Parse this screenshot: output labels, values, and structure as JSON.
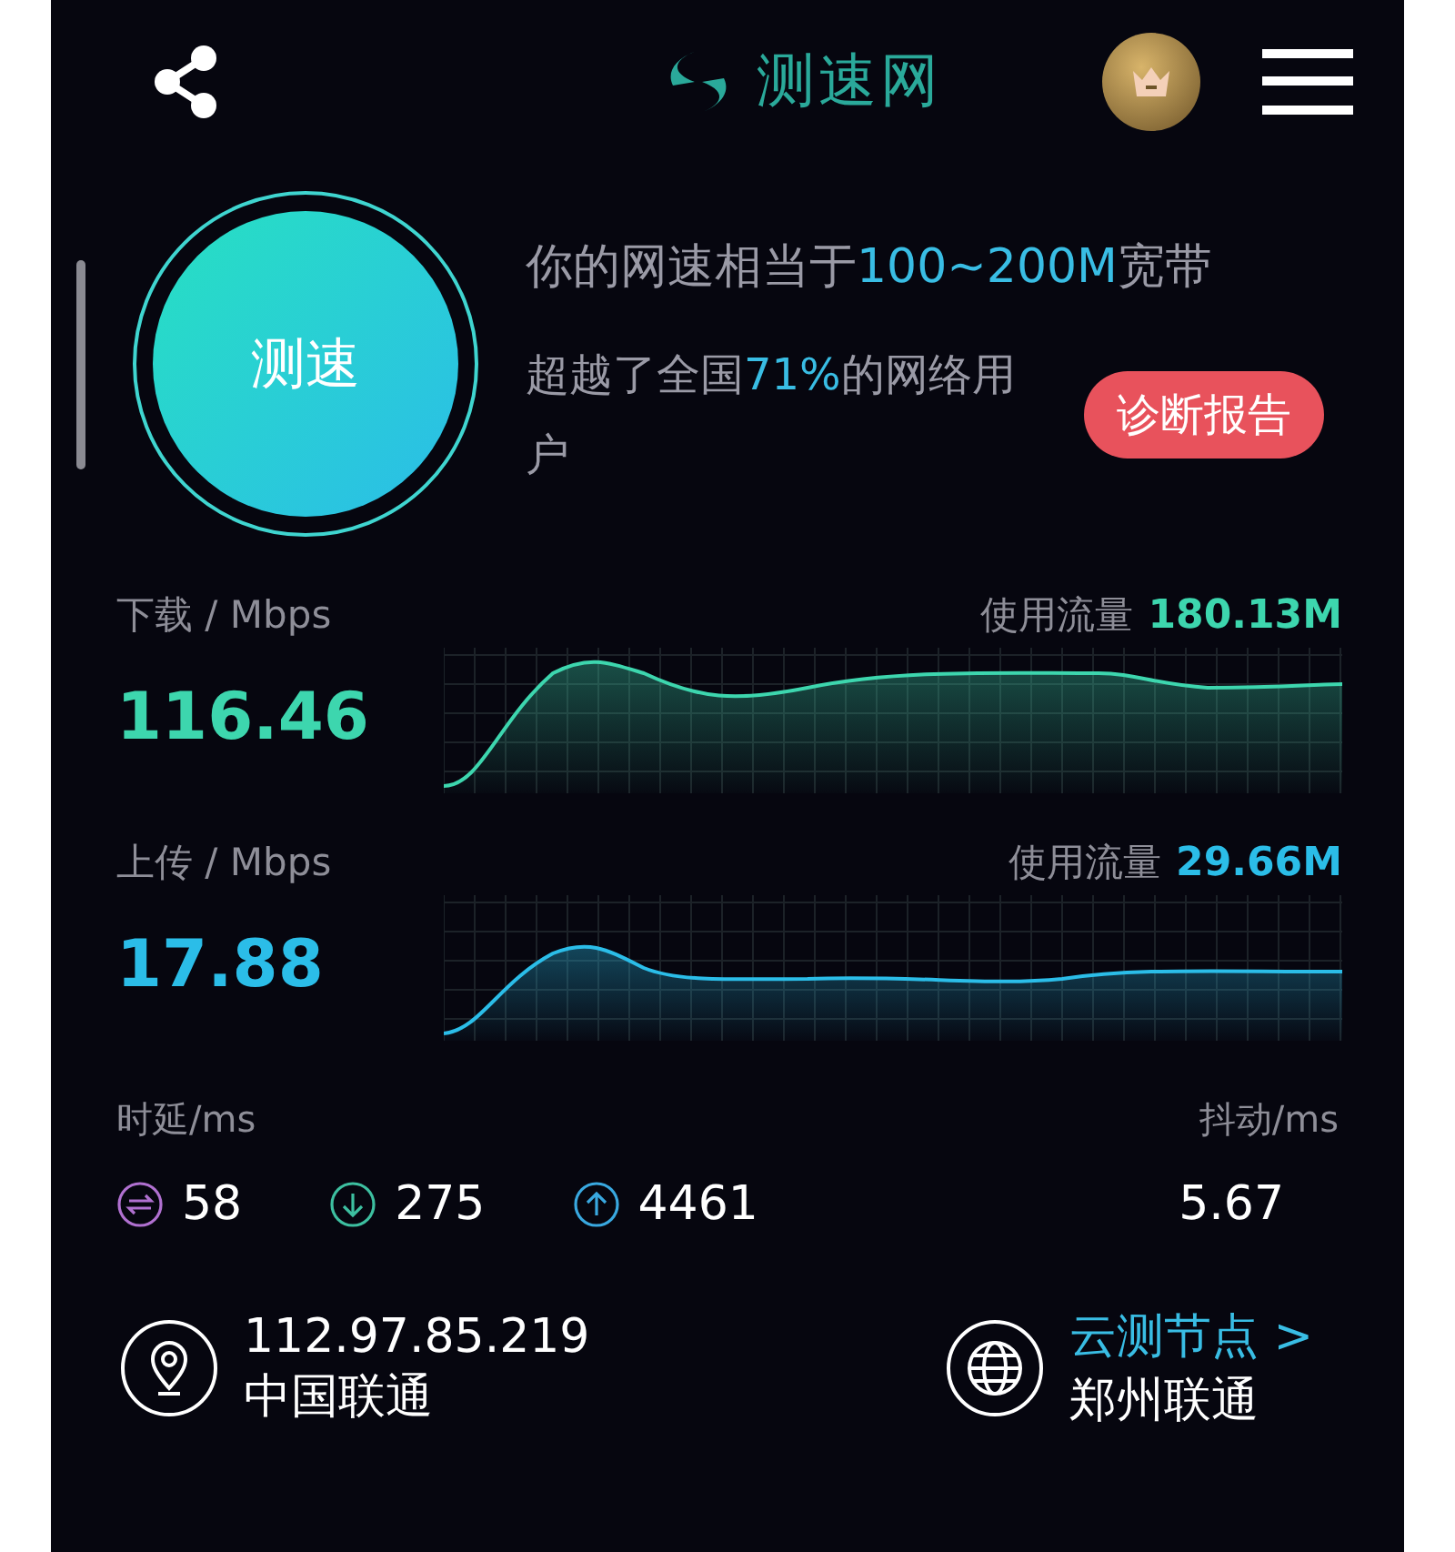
{
  "header": {
    "logo_text": "测速网"
  },
  "test_button": {
    "label": "测速"
  },
  "summary": {
    "lines": [
      "你的网速相当于**100~200M**宽带",
      "超越了全国**71%**的网络用户"
    ],
    "report_button": "诊断报告"
  },
  "meters": [
    {
      "kind": "download",
      "label": "下载 / Mbps",
      "value": "116.46",
      "usage_label": "使用流量",
      "usage": "180.13M"
    },
    {
      "kind": "upload",
      "label": "上传 / Mbps",
      "value": "17.88",
      "usage_label": "使用流量",
      "usage": "29.66M"
    }
  ],
  "latency": {
    "label": "时延/ms",
    "jitter_label": "抖动/ms",
    "jitter": "5.67",
    "items": [
      {
        "kind": "ping",
        "value": "58"
      },
      {
        "kind": "download",
        "value": "275"
      },
      {
        "kind": "upload",
        "value": "4461"
      }
    ]
  },
  "footer": {
    "ip": "112.97.85.219",
    "isp": "中国联通",
    "node_link": "云测节点 >",
    "node": "郑州联通"
  }
}
